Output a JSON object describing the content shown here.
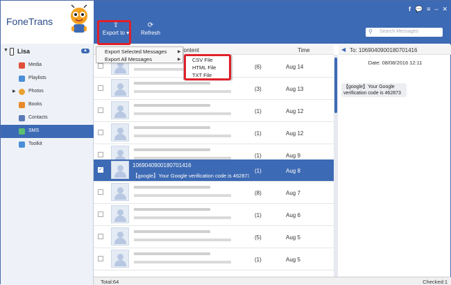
{
  "app": {
    "name": "FoneTrans"
  },
  "device": {
    "name": "Lisa"
  },
  "sidebar": {
    "items": [
      {
        "label": "Media",
        "icon": "music-icon",
        "color": "#e0503a"
      },
      {
        "label": "Playlists",
        "icon": "playlist-icon",
        "color": "#4a8fd8"
      },
      {
        "label": "Photos",
        "icon": "photos-icon",
        "color": "#e8a030"
      },
      {
        "label": "Books",
        "icon": "books-icon",
        "color": "#e88a2a"
      },
      {
        "label": "Contacts",
        "icon": "contacts-icon",
        "color": "#5a7ab8"
      },
      {
        "label": "SMS",
        "icon": "sms-icon",
        "color": "#5cc070"
      },
      {
        "label": "Toolkit",
        "icon": "toolkit-icon",
        "color": "#4a8fd8"
      }
    ]
  },
  "toolbar": {
    "export_label": "Export to",
    "refresh_label": "Refresh",
    "search_placeholder": "Search Messages",
    "accent": "#3d6ab4",
    "highlight": "#e0202a"
  },
  "list": {
    "header_content": "Content",
    "header_time": "Time",
    "rows": [
      {
        "count": "(6)",
        "date": "Aug 14"
      },
      {
        "count": "(3)",
        "date": "Aug 13"
      },
      {
        "count": "(1)",
        "date": "Aug 12"
      },
      {
        "count": "(1)",
        "date": "Aug 12"
      },
      {
        "count": "(1)",
        "date": "Aug 9"
      },
      {
        "count": "(1)",
        "date": "Aug 8",
        "selected": true,
        "number": "1069040900180701416",
        "preview": "【google】Your Google verification code is 462873"
      },
      {
        "count": "(8)",
        "date": "Aug 7"
      },
      {
        "count": "(1)",
        "date": "Aug 6"
      },
      {
        "count": "(5)",
        "date": "Aug 5"
      },
      {
        "count": "(1)",
        "date": "Aug 5"
      }
    ]
  },
  "export_menu": {
    "items": [
      "Export Selected Messages",
      "Export All Messages"
    ],
    "formats": [
      "CSV File",
      "HTML File",
      "TXT File"
    ]
  },
  "detail": {
    "to_label": "To: 1069040900180701416",
    "date": "Date: 08/08/2016 12:11",
    "message": "【google】Your Google verification code is 462873"
  },
  "status": {
    "total": "Total:64",
    "checked": "Checked:1"
  }
}
